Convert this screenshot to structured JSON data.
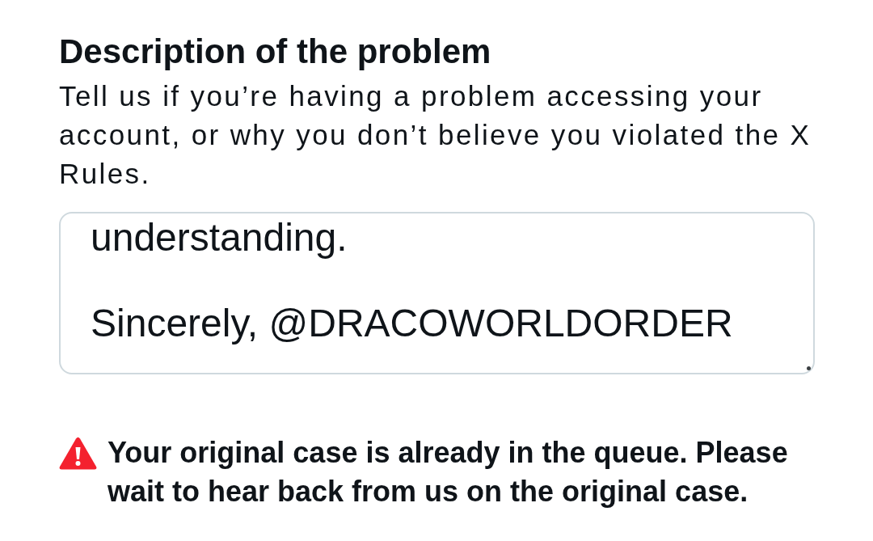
{
  "section": {
    "title": "Description of the problem",
    "description": "Tell us if you’re having a problem accessing your account, or why you don’t believe you violated the X Rules."
  },
  "message_field": {
    "lines": [
      "understanding.",
      "Sincerely, @DRACOWORLDORDER"
    ]
  },
  "alert": {
    "kind": "warning",
    "text": "Your original case is already in the queue. Please wait to hear back from us on the original case."
  }
}
